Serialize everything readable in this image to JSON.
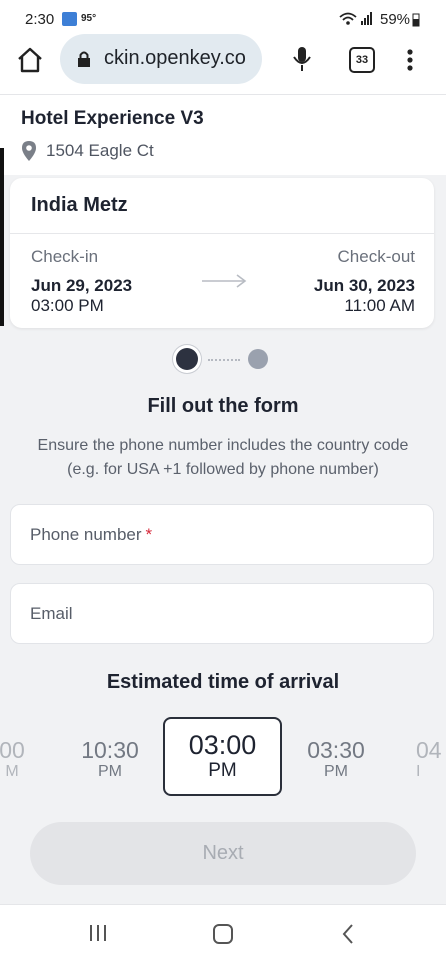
{
  "status_bar": {
    "time": "2:30",
    "temperature": "95°",
    "battery": "59%"
  },
  "browser": {
    "url": "ckin.openkey.co",
    "tab_count": "33"
  },
  "hotel": {
    "name": "Hotel Experience V3",
    "address": "1504 Eagle Ct"
  },
  "reservation": {
    "guest_name": "India Metz",
    "check_in": {
      "label": "Check-in",
      "date": "Jun 29, 2023",
      "time": "03:00 PM"
    },
    "check_out": {
      "label": "Check-out",
      "date": "Jun 30, 2023",
      "time": "11:00 AM"
    }
  },
  "form": {
    "title": "Fill out the form",
    "subtitle": "Ensure the phone number includes the country code (e.g. for USA +1 followed by phone number)",
    "phone_label": "Phone number",
    "required_mark": "*",
    "email_label": "Email"
  },
  "arrival": {
    "title": "Estimated time of arrival",
    "slots": [
      {
        "time": "00",
        "period": "M"
      },
      {
        "time": "10:30",
        "period": "PM"
      },
      {
        "time": "03:00",
        "period": "PM"
      },
      {
        "time": "03:30",
        "period": "PM"
      },
      {
        "time": "04",
        "period": "I"
      }
    ]
  },
  "next_button": "Next",
  "stepper": {
    "current_step": 1,
    "total_steps": 2
  }
}
